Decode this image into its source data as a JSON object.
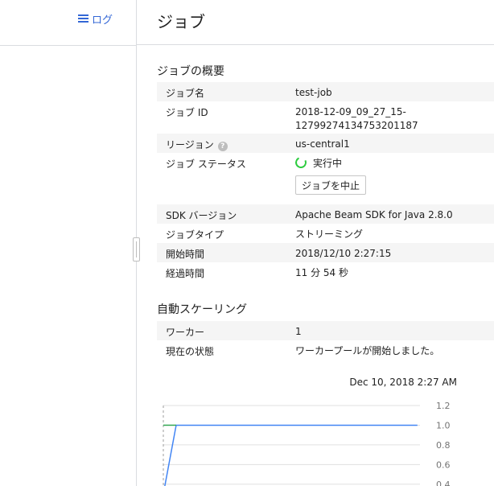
{
  "sidebar": {
    "log_link_label": "ログ"
  },
  "header": {
    "title": "ジョブ"
  },
  "job_summary": {
    "title": "ジョブの概要",
    "name_label": "ジョブ名",
    "name_value": "test-job",
    "id_label": "ジョブ ID",
    "id_value_line1": "2018-12-09_09_27_15-",
    "id_value_line2": "12799274134753201187",
    "region_label": "リージョン",
    "region_help_icon": "?",
    "region_value": "us-central1",
    "status_label": "ジョブ ステータス",
    "status_value": "実行中",
    "stop_button_label": "ジョブを中止",
    "sdk_label": "SDK バージョン",
    "sdk_value": "Apache Beam SDK for Java 2.8.0",
    "type_label": "ジョブタイプ",
    "type_value": "ストリーミング",
    "start_label": "開始時間",
    "start_value": "2018/12/10 2:27:15",
    "elapsed_label": "経過時間",
    "elapsed_value": "11 分 54 秒"
  },
  "autoscaling": {
    "title": "自動スケーリング",
    "workers_label": "ワーカー",
    "workers_value": "1",
    "state_label": "現在の状態",
    "state_value": "ワーカープールが開始しました。"
  },
  "colors": {
    "accent": "#3367d6",
    "running": "#2ecc40",
    "series_blue": "#4285f4",
    "series_green": "#34a853"
  },
  "chart_data": {
    "type": "line",
    "timestamp_label": "Dec 10, 2018 2:27 AM",
    "ylim": [
      0.3,
      1.2
    ],
    "yticks": [
      1.2,
      1.0,
      0.8,
      0.6,
      0.4
    ],
    "series": [
      {
        "color": "#4285f4",
        "points": [
          [
            0.0,
            0.3
          ],
          [
            0.05,
            1.0
          ],
          [
            0.99,
            1.0
          ]
        ]
      },
      {
        "color": "#34a853",
        "points": [
          [
            0.0,
            1.0
          ],
          [
            0.05,
            1.0
          ]
        ]
      }
    ]
  }
}
